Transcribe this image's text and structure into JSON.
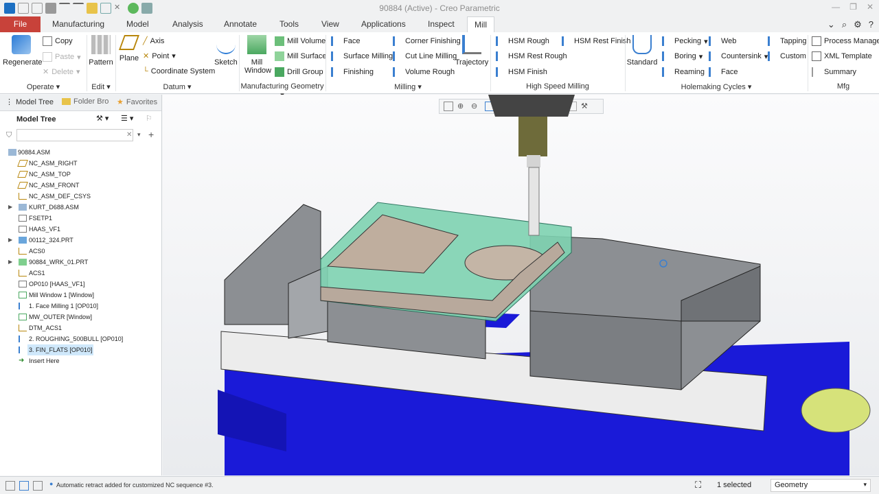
{
  "window": {
    "title": "90884 (Active) - Creo Parametric"
  },
  "tabs": [
    {
      "label": "File"
    },
    {
      "label": "Manufacturing"
    },
    {
      "label": "Model"
    },
    {
      "label": "Analysis"
    },
    {
      "label": "Annotate"
    },
    {
      "label": "Tools"
    },
    {
      "label": "View"
    },
    {
      "label": "Applications"
    },
    {
      "label": "Inspect"
    },
    {
      "label": "Mill"
    }
  ],
  "ribbon": {
    "operate": {
      "label": "Operate ▾",
      "regenerate": "Regenerate",
      "copy": "Copy",
      "paste": "Paste",
      "delete": "Delete"
    },
    "edit": {
      "label": "Edit ▾",
      "pattern": "Pattern"
    },
    "datum": {
      "label": "Datum ▾",
      "plane": "Plane",
      "axis": "Axis",
      "point": "Point",
      "csys": "Coordinate System",
      "sketch": "Sketch"
    },
    "mfg_geom": {
      "label": "Manufacturing Geometry ▾",
      "mill_window": "Mill Window",
      "mill_volume": "Mill Volume",
      "mill_surface": "Mill Surface",
      "drill_group": "Drill Group"
    },
    "milling": {
      "label": "Milling ▾",
      "face": "Face",
      "surface_milling": "Surface Milling",
      "finishing": "Finishing",
      "corner_finishing": "Corner Finishing",
      "cut_line_milling": "Cut Line Milling",
      "volume_rough": "Volume Rough",
      "trajectory": "Trajectory"
    },
    "hsm": {
      "label": "High Speed Milling",
      "hsm_rough": "HSM Rough",
      "hsm_rest_rough": "HSM Rest Rough",
      "hsm_finish": "HSM Finish",
      "hsm_rest_finish": "HSM Rest Finish"
    },
    "holemaking": {
      "label": "Holemaking Cycles ▾",
      "standard": "Standard",
      "pecking": "Pecking",
      "boring": "Boring",
      "reaming": "Reaming",
      "web": "Web",
      "countersink": "Countersink",
      "face": "Face",
      "tapping": "Tapping",
      "custom": "Custom"
    },
    "mfg": {
      "label": "Mfg",
      "process_manager": "Process Manager",
      "xml_template": "XML Template",
      "summary": "Summary"
    }
  },
  "panel": {
    "tabs": [
      {
        "label": "Model Tree"
      },
      {
        "label": "Folder Bro"
      },
      {
        "label": "Favorites"
      }
    ],
    "title": "Model Tree",
    "filter_placeholder": ""
  },
  "tree": [
    {
      "label": "90884.ASM",
      "expand": ""
    },
    {
      "label": "NC_ASM_RIGHT",
      "expand": ""
    },
    {
      "label": "NC_ASM_TOP",
      "expand": ""
    },
    {
      "label": "NC_ASM_FRONT",
      "expand": ""
    },
    {
      "label": "NC_ASM_DEF_CSYS",
      "expand": ""
    },
    {
      "label": "KURT_D688.ASM",
      "expand": "▶"
    },
    {
      "label": "FSETP1",
      "expand": ""
    },
    {
      "label": "HAAS_VF1",
      "expand": ""
    },
    {
      "label": "00112_324.PRT",
      "expand": "▶"
    },
    {
      "label": "ACS0",
      "expand": ""
    },
    {
      "label": "90884_WRK_01.PRT",
      "expand": "▶"
    },
    {
      "label": "ACS1",
      "expand": ""
    },
    {
      "label": "OP010 [HAAS_VF1]",
      "expand": ""
    },
    {
      "label": "Mill Window 1 [Window]",
      "expand": ""
    },
    {
      "label": "1. Face Milling 1 [OP010]",
      "expand": ""
    },
    {
      "label": "MW_OUTER [Window]",
      "expand": ""
    },
    {
      "label": "DTM_ACS1",
      "expand": ""
    },
    {
      "label": "2. ROUGHING_500BULL [OP010]",
      "expand": ""
    },
    {
      "label": "3. FIN_FLATS [OP010]",
      "expand": ""
    },
    {
      "label": "Insert Here",
      "expand": ""
    }
  ],
  "status": {
    "message": "Automatic retract added for customized NC sequence #3.",
    "selected": "1 selected",
    "filter": "Geometry"
  },
  "colors": {
    "file_tab": "#c8423a",
    "vise_blue": "#1a1ad8",
    "stock_green": "#7fd3b2",
    "jaw_gray": "#8c8f93"
  }
}
